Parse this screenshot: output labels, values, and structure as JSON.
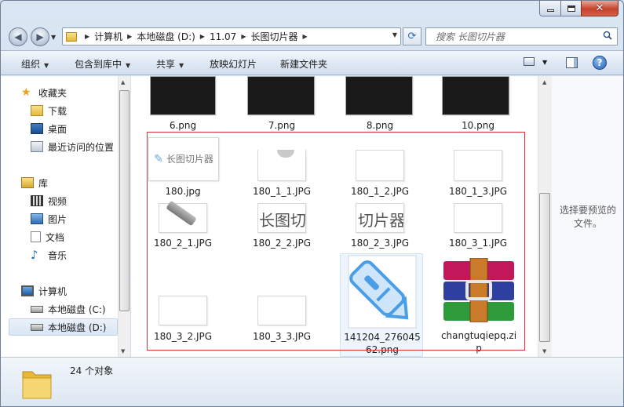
{
  "window": {
    "address_crumbs": [
      "计算机",
      "本地磁盘 (D:)",
      "11.07",
      "长图切片器"
    ],
    "search_placeholder": "搜索 长图切片器"
  },
  "toolbar": {
    "organize": "组织",
    "include_library": "包含到库中",
    "share": "共享",
    "slideshow": "放映幻灯片",
    "new_folder": "新建文件夹"
  },
  "sidebar": {
    "favorites_header": "收藏夹",
    "downloads": "下载",
    "desktop": "桌面",
    "recent": "最近访问的位置",
    "libraries_header": "库",
    "videos": "视频",
    "pictures": "图片",
    "documents": "文档",
    "music": "音乐",
    "computer_header": "计算机",
    "drive_c": "本地磁盘 (C:)",
    "drive_d": "本地磁盘 (D:)"
  },
  "files": {
    "f1": "6.png",
    "f2": "7.png",
    "f3": "8.png",
    "f4": "10.png",
    "f5": "180.jpg",
    "f6": "180_1_1.JPG",
    "f7": "180_1_2.JPG",
    "f8": "180_1_3.JPG",
    "f9": "180_2_1.JPG",
    "f10": "180_2_2.JPG",
    "f11": "180_2_3.JPG",
    "f12": "180_3_1.JPG",
    "f13": "180_3_2.JPG",
    "f14": "180_3_3.JPG",
    "f15a": "141204_276045",
    "f15b": "62.png",
    "f16a": "changtuqiepq.zi",
    "f16b": "p"
  },
  "thumb_text": {
    "t180": "长图切片器",
    "t2_2": "长图切",
    "t2_3": "切片器"
  },
  "preview_text_1": "选择要预览的",
  "preview_text_2": "文件。",
  "status": {
    "count": "24 个对象"
  }
}
